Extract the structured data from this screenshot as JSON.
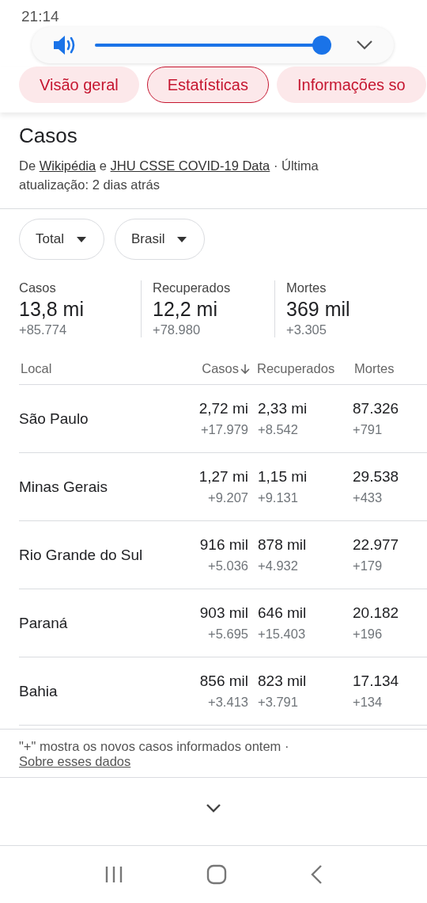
{
  "status_bar": {
    "time": "21:14"
  },
  "volume_panel": {
    "level": 0.97
  },
  "tabs": [
    {
      "label": "Visão geral",
      "selected": false
    },
    {
      "label": "Estatísticas",
      "selected": true
    },
    {
      "label": "Informações so",
      "selected": false
    }
  ],
  "section": {
    "title": "Casos",
    "source_prefix": "De",
    "source_link_1": "Wikipédia",
    "source_joiner": "e",
    "source_link_2": "JHU CSSE COVID-19 Data",
    "source_suffix": "· Última atualização: 2 dias atrás"
  },
  "filters": [
    {
      "label": "Total"
    },
    {
      "label": "Brasil"
    }
  ],
  "summary": [
    {
      "label": "Casos",
      "value": "13,8 mi",
      "delta": "+85.774"
    },
    {
      "label": "Recuperados",
      "value": "12,2 mi",
      "delta": "+78.980"
    },
    {
      "label": "Mortes",
      "value": "369 mil",
      "delta": "+3.305"
    }
  ],
  "table": {
    "columns": [
      {
        "label": "Local",
        "sorted": false
      },
      {
        "label": "Casos",
        "sorted": true
      },
      {
        "label": "Recuperados",
        "sorted": false
      },
      {
        "label": "Mortes",
        "sorted": false
      }
    ],
    "rows": [
      {
        "place": "São Paulo",
        "cases": "2,72 mi",
        "cases_delta": "+17.979",
        "recovered": "2,33 mi",
        "recovered_delta": "+8.542",
        "deaths": "87.326",
        "deaths_delta": "+791"
      },
      {
        "place": "Minas Gerais",
        "cases": "1,27 mi",
        "cases_delta": "+9.207",
        "recovered": "1,15 mi",
        "recovered_delta": "+9.131",
        "deaths": "29.538",
        "deaths_delta": "+433"
      },
      {
        "place": "Rio Grande do Sul",
        "cases": "916 mil",
        "cases_delta": "+5.036",
        "recovered": "878 mil",
        "recovered_delta": "+4.932",
        "deaths": "22.977",
        "deaths_delta": "+179"
      },
      {
        "place": "Paraná",
        "cases": "903 mil",
        "cases_delta": "+5.695",
        "recovered": "646 mil",
        "recovered_delta": "+15.403",
        "deaths": "20.182",
        "deaths_delta": "+196"
      },
      {
        "place": "Bahia",
        "cases": "856 mil",
        "cases_delta": "+3.413",
        "recovered": "823 mil",
        "recovered_delta": "+3.791",
        "deaths": "17.134",
        "deaths_delta": "+134"
      }
    ]
  },
  "footnote": {
    "text": "\"+\" mostra os novos casos informados ontem ·",
    "link": "Sobre esses dados"
  }
}
